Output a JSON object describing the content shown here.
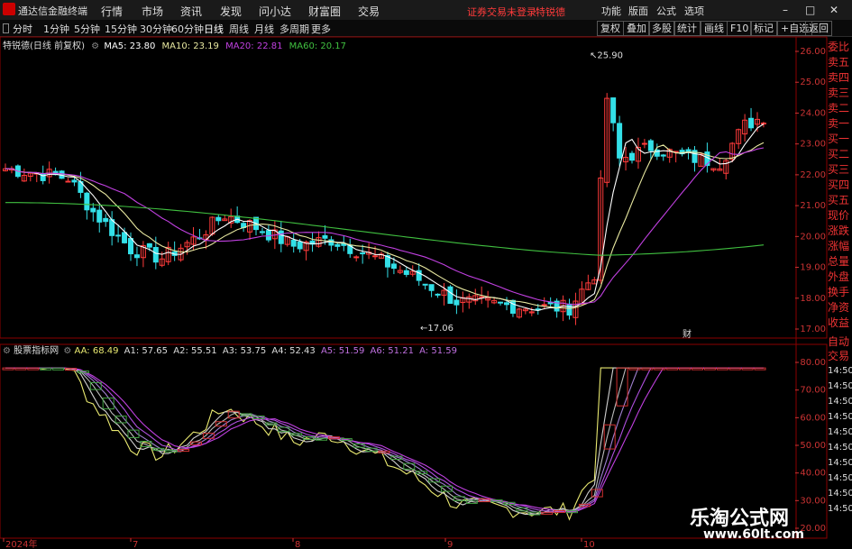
{
  "titlebar": {
    "app_name": "通达信金融终端",
    "menus": [
      "行情",
      "市场",
      "资讯",
      "发现",
      "问小达",
      "财富圈",
      "交易"
    ],
    "alert": "证券交易未登录",
    "alert_stock": "特锐德",
    "right_menus": [
      "功能",
      "版面",
      "公式",
      "选项"
    ],
    "window_controls": [
      "–",
      "□",
      "✕"
    ]
  },
  "toolbar": {
    "periods": [
      "分时",
      "1分钟",
      "5分钟",
      "15分钟",
      "30分钟",
      "60分钟",
      "日线",
      "周线",
      "月线",
      "多周期",
      "更多"
    ],
    "active_period": "日线",
    "right_buttons": [
      "复权",
      "叠加",
      "多股",
      "统计",
      "画线",
      "F10",
      "标记",
      "+自选",
      "返回"
    ]
  },
  "ma_legend": {
    "stock": "特锐德(日线 前复权)",
    "ma5": "MA5: 23.80",
    "ma10": "MA10: 23.19",
    "ma20": "MA20: 22.81",
    "ma60": "MA60: 20.17"
  },
  "indicator_legend": {
    "name": "股票指标网",
    "aa": "AA: 68.49",
    "a1": "A1: 57.65",
    "a2": "A2: 55.51",
    "a3": "A3: 53.75",
    "a4": "A4: 52.43",
    "a5": "A5: 51.59",
    "a6": "A6: 51.21",
    "a": "A: 51.59"
  },
  "price_axis": [
    "26.00",
    "25.00",
    "24.00",
    "23.00",
    "22.00",
    "21.00",
    "20.00",
    "19.00",
    "18.00",
    "17.00"
  ],
  "indicator_axis": [
    "80.00",
    "70.00",
    "60.00",
    "50.00",
    "40.00",
    "30.00",
    "20.00"
  ],
  "annotations": {
    "high": "25.90",
    "low": "17.06",
    "marker": "财"
  },
  "date_axis": [
    "2024年",
    "7",
    "8",
    "9",
    "10"
  ],
  "side_panel": [
    "委比",
    "卖五",
    "卖四",
    "卖三",
    "卖二",
    "卖一",
    "买一",
    "买二",
    "买三",
    "买四",
    "买五",
    "现价",
    "涨跌",
    "涨幅",
    "总量",
    "外盘",
    "换手",
    "净资",
    "收益"
  ],
  "side_panel_lower": [
    "自动",
    "交易"
  ],
  "time_list": [
    "14:50",
    "14:50",
    "14:50",
    "14:50",
    "14:50",
    "14:50",
    "14:50",
    "14:50",
    "14:50",
    "14:50"
  ],
  "colors": {
    "up": "#ff3b3b",
    "down": "#33e0e8",
    "ma5": "#ffffff",
    "ma10": "#e8e8a0",
    "ma20": "#c040e0",
    "ma60": "#40c040"
  },
  "watermark": {
    "title": "乐淘公式网",
    "url": "www.60lt.com"
  }
}
